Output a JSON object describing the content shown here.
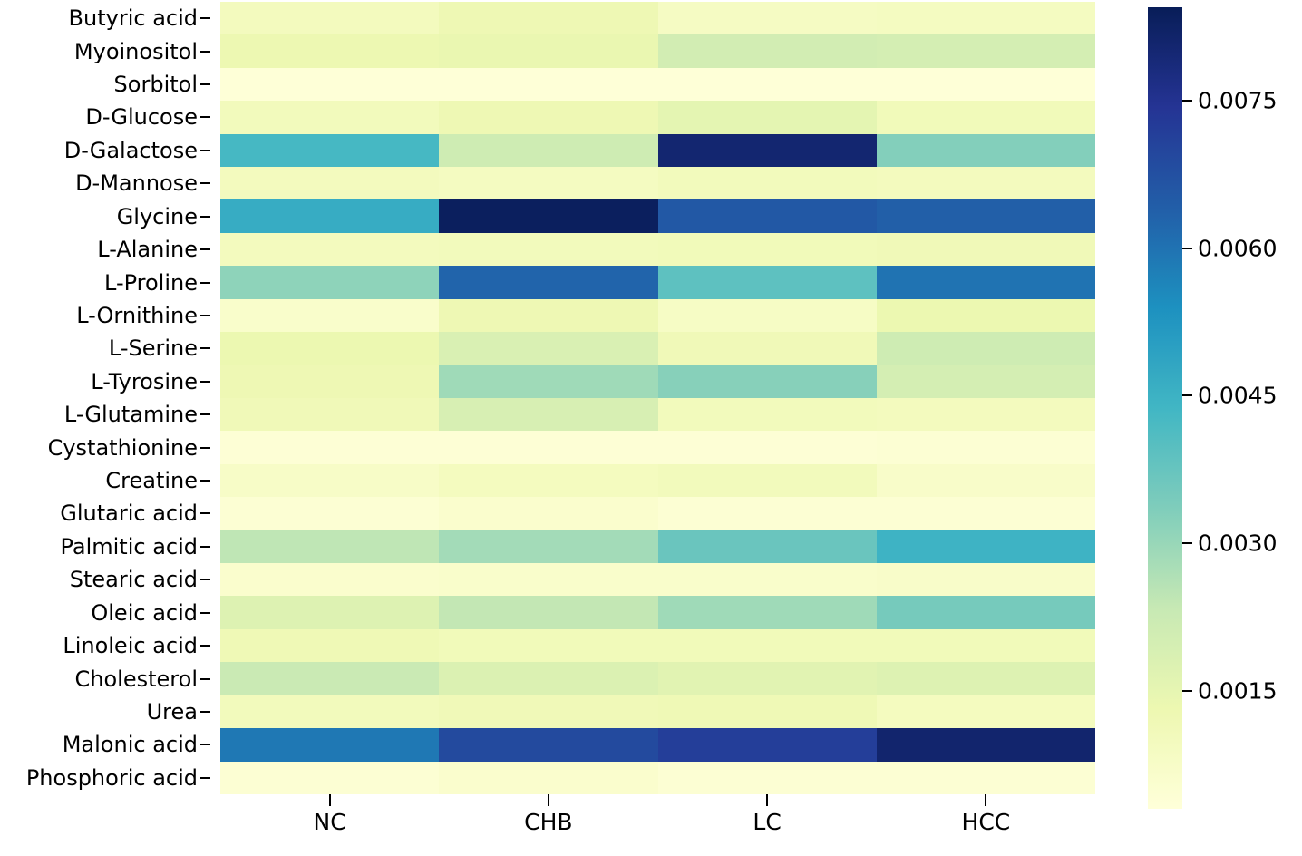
{
  "chart_data": {
    "type": "heatmap",
    "title": "",
    "xlabel": "",
    "ylabel": "",
    "colormap": "YlGnBu",
    "grid": false,
    "legend_position": "right-colorbar",
    "categories": [
      "NC",
      "CHB",
      "LC",
      "HCC"
    ],
    "rows": [
      "Butyric acid",
      "Myoinositol",
      "Sorbitol",
      "D-Glucose",
      "D-Galactose",
      "D-Mannose",
      "Glycine",
      "L-Alanine",
      "L-Proline",
      "L-Ornithine",
      "L-Serine",
      "L-Tyrosine",
      "L-Glutamine",
      "Cystathionine",
      "Creatine",
      "Glutaric acid",
      "Palmitic acid",
      "Stearic acid",
      "Oleic acid",
      "Linoleic acid",
      "Cholesterol",
      "Urea",
      "Malonic acid",
      "Phosphoric acid"
    ],
    "values": [
      [
        0.001,
        0.00125,
        0.00085,
        0.0009
      ],
      [
        0.0013,
        0.0014,
        0.00205,
        0.002
      ],
      [
        0.00035,
        0.00035,
        0.00035,
        0.00035
      ],
      [
        0.00105,
        0.00125,
        0.00155,
        0.0011
      ],
      [
        0.0043,
        0.00215,
        0.00805,
        0.0033
      ],
      [
        0.001,
        0.0009,
        0.00105,
        0.001
      ],
      [
        0.00465,
        0.00835,
        0.00655,
        0.0064
      ],
      [
        0.001,
        0.00105,
        0.0011,
        0.00115
      ],
      [
        0.00315,
        0.0063,
        0.0039,
        0.006
      ],
      [
        0.00065,
        0.00125,
        0.0008,
        0.00135
      ],
      [
        0.00135,
        0.00185,
        0.00115,
        0.00215
      ],
      [
        0.00125,
        0.0029,
        0.00325,
        0.002
      ],
      [
        0.00115,
        0.0019,
        0.00105,
        0.001
      ],
      [
        0.0004,
        0.0004,
        0.0004,
        0.00045
      ],
      [
        0.00075,
        0.00095,
        0.00105,
        0.0007
      ],
      [
        0.00045,
        0.0006,
        0.00045,
        0.00045
      ],
      [
        0.00245,
        0.00285,
        0.0037,
        0.00445
      ],
      [
        0.0006,
        0.00065,
        0.00065,
        0.0007
      ],
      [
        0.00175,
        0.0024,
        0.0029,
        0.0035
      ],
      [
        0.0012,
        0.0011,
        0.0011,
        0.0011
      ],
      [
        0.00225,
        0.0018,
        0.00165,
        0.00175
      ],
      [
        0.00105,
        0.00115,
        0.0012,
        0.00095
      ],
      [
        0.0059,
        0.0069,
        0.0072,
        0.0081
      ],
      [
        0.00045,
        0.0006,
        0.00045,
        0.00045
      ]
    ],
    "colorbar": {
      "ticks": [
        "0.0075",
        "0.0060",
        "0.0045",
        "0.0030",
        "0.0015"
      ],
      "tick_values": [
        0.0075,
        0.006,
        0.0045,
        0.003,
        0.0015
      ],
      "vmin": 0.0003,
      "vmax": 0.00845
    }
  }
}
